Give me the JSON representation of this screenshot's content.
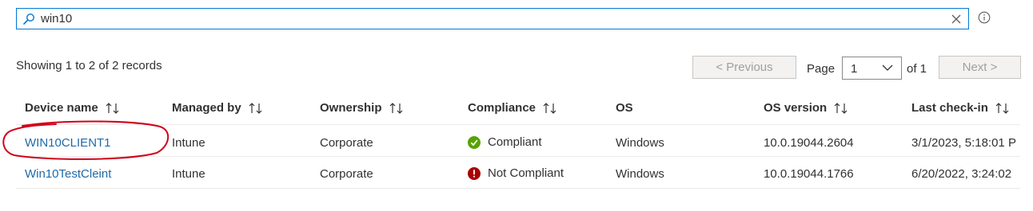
{
  "search": {
    "value": "win10",
    "placeholder": ""
  },
  "summary": {
    "records_text": "Showing 1 to 2 of 2 records"
  },
  "pagination": {
    "previous_label": "< Previous",
    "page_label": "Page",
    "page_value": "1",
    "of_label": "of 1",
    "next_label": "Next >"
  },
  "table": {
    "columns": [
      "Device name",
      "Managed by",
      "Ownership",
      "Compliance",
      "OS",
      "OS version",
      "Last check-in"
    ],
    "rows": [
      {
        "device_name": "WIN10CLIENT1",
        "managed_by": "Intune",
        "ownership": "Corporate",
        "compliance": "Compliant",
        "compliance_icon": "check-circle-icon",
        "os": "Windows",
        "os_version": "10.0.19044.2604",
        "last_checkin": "3/1/2023, 5:18:01 P"
      },
      {
        "device_name": "Win10TestCleint",
        "managed_by": "Intune",
        "ownership": "Corporate",
        "compliance": "Not Compliant",
        "compliance_icon": "error-circle-icon",
        "os": "Windows",
        "os_version": "10.0.19044.1766",
        "last_checkin": "6/20/2022, 3:24:02"
      }
    ]
  },
  "colors": {
    "accent": "#0078d4",
    "link": "#1e6aa8",
    "compliant": "#57a300",
    "not_compliant": "#a80000",
    "annotation": "#d0021b"
  }
}
